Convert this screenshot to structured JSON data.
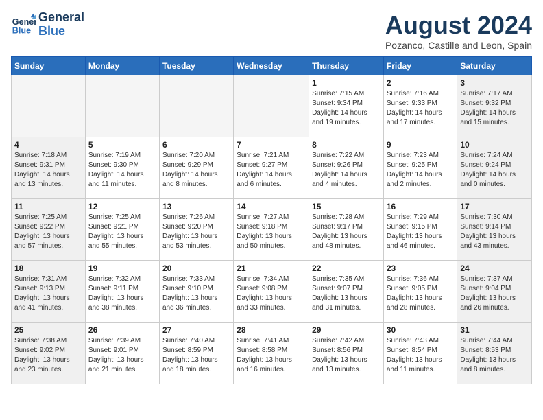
{
  "header": {
    "logo_line1": "General",
    "logo_line2": "Blue",
    "month": "August 2024",
    "location": "Pozanco, Castille and Leon, Spain"
  },
  "weekdays": [
    "Sunday",
    "Monday",
    "Tuesday",
    "Wednesday",
    "Thursday",
    "Friday",
    "Saturday"
  ],
  "weeks": [
    [
      {
        "day": "",
        "info": ""
      },
      {
        "day": "",
        "info": ""
      },
      {
        "day": "",
        "info": ""
      },
      {
        "day": "",
        "info": ""
      },
      {
        "day": "1",
        "info": "Sunrise: 7:15 AM\nSunset: 9:34 PM\nDaylight: 14 hours\nand 19 minutes."
      },
      {
        "day": "2",
        "info": "Sunrise: 7:16 AM\nSunset: 9:33 PM\nDaylight: 14 hours\nand 17 minutes."
      },
      {
        "day": "3",
        "info": "Sunrise: 7:17 AM\nSunset: 9:32 PM\nDaylight: 14 hours\nand 15 minutes."
      }
    ],
    [
      {
        "day": "4",
        "info": "Sunrise: 7:18 AM\nSunset: 9:31 PM\nDaylight: 14 hours\nand 13 minutes."
      },
      {
        "day": "5",
        "info": "Sunrise: 7:19 AM\nSunset: 9:30 PM\nDaylight: 14 hours\nand 11 minutes."
      },
      {
        "day": "6",
        "info": "Sunrise: 7:20 AM\nSunset: 9:29 PM\nDaylight: 14 hours\nand 8 minutes."
      },
      {
        "day": "7",
        "info": "Sunrise: 7:21 AM\nSunset: 9:27 PM\nDaylight: 14 hours\nand 6 minutes."
      },
      {
        "day": "8",
        "info": "Sunrise: 7:22 AM\nSunset: 9:26 PM\nDaylight: 14 hours\nand 4 minutes."
      },
      {
        "day": "9",
        "info": "Sunrise: 7:23 AM\nSunset: 9:25 PM\nDaylight: 14 hours\nand 2 minutes."
      },
      {
        "day": "10",
        "info": "Sunrise: 7:24 AM\nSunset: 9:24 PM\nDaylight: 14 hours\nand 0 minutes."
      }
    ],
    [
      {
        "day": "11",
        "info": "Sunrise: 7:25 AM\nSunset: 9:22 PM\nDaylight: 13 hours\nand 57 minutes."
      },
      {
        "day": "12",
        "info": "Sunrise: 7:25 AM\nSunset: 9:21 PM\nDaylight: 13 hours\nand 55 minutes."
      },
      {
        "day": "13",
        "info": "Sunrise: 7:26 AM\nSunset: 9:20 PM\nDaylight: 13 hours\nand 53 minutes."
      },
      {
        "day": "14",
        "info": "Sunrise: 7:27 AM\nSunset: 9:18 PM\nDaylight: 13 hours\nand 50 minutes."
      },
      {
        "day": "15",
        "info": "Sunrise: 7:28 AM\nSunset: 9:17 PM\nDaylight: 13 hours\nand 48 minutes."
      },
      {
        "day": "16",
        "info": "Sunrise: 7:29 AM\nSunset: 9:15 PM\nDaylight: 13 hours\nand 46 minutes."
      },
      {
        "day": "17",
        "info": "Sunrise: 7:30 AM\nSunset: 9:14 PM\nDaylight: 13 hours\nand 43 minutes."
      }
    ],
    [
      {
        "day": "18",
        "info": "Sunrise: 7:31 AM\nSunset: 9:13 PM\nDaylight: 13 hours\nand 41 minutes."
      },
      {
        "day": "19",
        "info": "Sunrise: 7:32 AM\nSunset: 9:11 PM\nDaylight: 13 hours\nand 38 minutes."
      },
      {
        "day": "20",
        "info": "Sunrise: 7:33 AM\nSunset: 9:10 PM\nDaylight: 13 hours\nand 36 minutes."
      },
      {
        "day": "21",
        "info": "Sunrise: 7:34 AM\nSunset: 9:08 PM\nDaylight: 13 hours\nand 33 minutes."
      },
      {
        "day": "22",
        "info": "Sunrise: 7:35 AM\nSunset: 9:07 PM\nDaylight: 13 hours\nand 31 minutes."
      },
      {
        "day": "23",
        "info": "Sunrise: 7:36 AM\nSunset: 9:05 PM\nDaylight: 13 hours\nand 28 minutes."
      },
      {
        "day": "24",
        "info": "Sunrise: 7:37 AM\nSunset: 9:04 PM\nDaylight: 13 hours\nand 26 minutes."
      }
    ],
    [
      {
        "day": "25",
        "info": "Sunrise: 7:38 AM\nSunset: 9:02 PM\nDaylight: 13 hours\nand 23 minutes."
      },
      {
        "day": "26",
        "info": "Sunrise: 7:39 AM\nSunset: 9:01 PM\nDaylight: 13 hours\nand 21 minutes."
      },
      {
        "day": "27",
        "info": "Sunrise: 7:40 AM\nSunset: 8:59 PM\nDaylight: 13 hours\nand 18 minutes."
      },
      {
        "day": "28",
        "info": "Sunrise: 7:41 AM\nSunset: 8:58 PM\nDaylight: 13 hours\nand 16 minutes."
      },
      {
        "day": "29",
        "info": "Sunrise: 7:42 AM\nSunset: 8:56 PM\nDaylight: 13 hours\nand 13 minutes."
      },
      {
        "day": "30",
        "info": "Sunrise: 7:43 AM\nSunset: 8:54 PM\nDaylight: 13 hours\nand 11 minutes."
      },
      {
        "day": "31",
        "info": "Sunrise: 7:44 AM\nSunset: 8:53 PM\nDaylight: 13 hours\nand 8 minutes."
      }
    ]
  ]
}
